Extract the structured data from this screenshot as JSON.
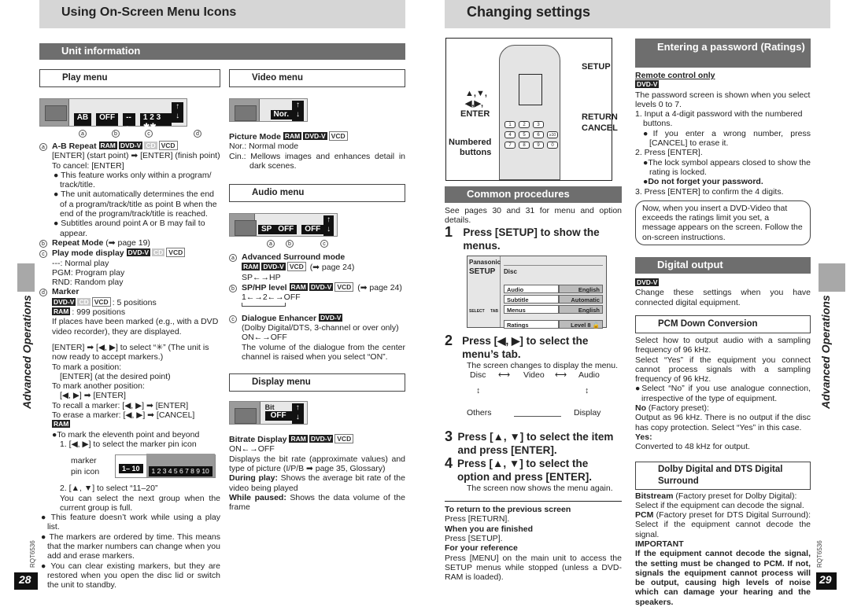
{
  "left_page": {
    "title": "Using On-Screen Menu Icons",
    "section": "Unit information",
    "side_label": "Advanced Operations",
    "doc_code": "RQT6536",
    "page_number": "28",
    "play_menu": {
      "title": "Play menu",
      "osd_values": [
        "AB",
        "OFF",
        "---",
        "1 2 3 ✱✱"
      ],
      "callouts": [
        "a",
        "b",
        "c",
        "d"
      ],
      "ab_repeat": {
        "label": "A-B Repeat",
        "tags": [
          "RAM",
          "DVD-V",
          "CD",
          "VCD"
        ],
        "lines": [
          "[ENTER] (start point) ➡ [ENTER] (finish point)",
          "To cancel: [ENTER]"
        ],
        "bullets": [
          "This feature works only within a program/ track/title.",
          "The unit automatically determines the end of a program/track/title as point B when the end of the program/track/title is reached.",
          "Subtitles around point A or B may fail to appear."
        ]
      },
      "repeat_mode": {
        "label": "Repeat Mode",
        "ref": "(➡ page 19)"
      },
      "play_mode": {
        "label": "Play mode display",
        "tags": [
          "DVD-V",
          "CD",
          "VCD"
        ],
        "lines": [
          "---: Normal play",
          "PGM: Program play",
          "RND: Random play"
        ]
      },
      "marker": {
        "label": "Marker",
        "tags_line1": [
          "DVD-V",
          "CD",
          "VCD"
        ],
        "line1": ": 5 positions",
        "tag_line2": "RAM",
        "line2": ": 999 positions",
        "desc": "If places have been marked (e.g., with a DVD video recorder), they are displayed.",
        "instr": [
          "[ENTER] ➡ [◀, ▶] to select “✳” (The unit is now ready to accept markers.)",
          "To mark a position:",
          "[ENTER] (at the desired point)",
          "To mark another position:",
          "[◀, ▶] ➡ [ENTER]",
          "To recall a marker:  [◀, ▶] ➡ [ENTER]",
          "To erase a marker:  [◀, ▶] ➡ [CANCEL]"
        ],
        "ram_tag": "RAM",
        "ram_bullet": "To mark the eleventh point and beyond",
        "step1": "1. [◀, ▶] to select the marker pin icon",
        "pin_label1": "marker",
        "pin_label2": "pin icon",
        "pin_group": "1– 10",
        "pin_numbers": "1 2 3 4 5 6 7 8 9 10",
        "step2": "2. [▲, ▼] to select “11–20”",
        "step2_desc": "You can select the next group when the current group is full.",
        "bullets": [
          "This feature doesn’t work while using a play list.",
          "The markers are ordered by time. This means that the marker numbers can change when you add and erase markers.",
          "You can clear existing markers, but they are restored when you open the disc lid or switch the unit to standby."
        ]
      }
    },
    "video_menu": {
      "title": "Video menu",
      "osd_value": "Nor.",
      "label": "Picture Mode",
      "tags": [
        "RAM",
        "DVD-V",
        "VCD"
      ],
      "lines": [
        "Nor.: Normal mode",
        "Cin.: Mellows images and enhances detail in dark scenes."
      ]
    },
    "audio_menu": {
      "title": "Audio menu",
      "osd_values": [
        "SP",
        "OFF",
        "OFF"
      ],
      "callouts": [
        "a",
        "b",
        "c"
      ],
      "surround": {
        "label": "Advanced Surround mode",
        "tags": [
          "RAM",
          "DVD-V",
          "VCD"
        ],
        "ref": "(➡ page 24)",
        "line": "SP←→HP"
      },
      "level": {
        "label": "SP/HP level",
        "tags": [
          "RAM",
          "DVD-V",
          "VCD"
        ],
        "ref": "(➡ page 24)",
        "line": "1←→2←→OFF"
      },
      "dialogue": {
        "label": "Dialogue Enhancer",
        "tags": [
          "DVD-V"
        ],
        "lines": [
          "(Dolby Digital/DTS, 3-channel or over only)",
          "ON←→OFF",
          "The volume of the dialogue from the center channel is raised when you select “ON”."
        ]
      }
    },
    "display_menu": {
      "title": "Display menu",
      "osd_label": "Bit",
      "osd_value": "OFF",
      "label": "Bitrate Display",
      "tags": [
        "RAM",
        "DVD-V",
        "VCD"
      ],
      "line": "ON←→OFF",
      "desc": "Displays the bit rate (approximate values) and type of picture (I/P/B ➡ page 35, Glossary)",
      "during_label": "During play:",
      "during_text": " Shows the average bit rate of the video being played",
      "paused_label": "While paused:",
      "paused_text": " Shows the data volume of the frame"
    }
  },
  "right_page": {
    "title": "Changing settings",
    "side_label": "Advanced Operations",
    "doc_code": "RQT6536",
    "page_number": "29",
    "remote": {
      "labels": {
        "setup": "SETUP",
        "arrows": "▲,▼,\n◀,▶,",
        "enter": "ENTER",
        "return": "RETURN",
        "cancel": "CANCEL",
        "numbered": "Numbered",
        "buttons": "buttons"
      },
      "keys": [
        "1",
        "2",
        "3",
        "4",
        "5",
        "6",
        "≥10",
        "7",
        "8",
        "9",
        "0"
      ]
    },
    "common": {
      "title": "Common procedures",
      "intro": "See pages 30 and 31 for menu and option details.",
      "step1": "Press [SETUP] to show the menus.",
      "screen": {
        "brand": "Panasonic",
        "setup": "SETUP",
        "tab": "Disc",
        "select": "SELECT",
        "tab_lbl": "TAB",
        "rows": [
          {
            "item": "Audio",
            "value": "English"
          },
          {
            "item": "Subtitle",
            "value": "Automatic"
          },
          {
            "item": "Menus",
            "value": "English"
          },
          {
            "item": "Ratings",
            "value": "Level 8 🔓"
          }
        ]
      },
      "step2": "Press [◀, ▶] to select the menu’s tab.",
      "step2_desc": "The screen changes to display the menu.",
      "tabs": [
        "Disc",
        "Video",
        "Audio",
        "Others",
        "Display"
      ],
      "step3": "Press [▲, ▼] to select the item and press [ENTER].",
      "step4": "Press [▲, ▼] to select the option and press [ENTER].",
      "step4_desc": "The screen now shows the menu again.",
      "notes": [
        {
          "h": "To return to the previous screen",
          "t": "Press [RETURN]."
        },
        {
          "h": "When you are finished",
          "t": "Press [SETUP]."
        },
        {
          "h": "For your reference",
          "t": "Press [MENU] on the main unit to access the SETUP menus while stopped (unless a DVD-RAM is loaded)."
        }
      ]
    },
    "password": {
      "title": "Entering a password (Ratings)",
      "remote_only": "Remote control only",
      "tag": "DVD-V",
      "intro": "The password screen is shown when you select levels 0 to 7.",
      "steps": [
        "1. Input a 4-digit password with the numbered buttons.",
        "●If you enter a wrong number, press [CANCEL] to erase it.",
        "2. Press [ENTER].",
        "●The lock symbol appears closed to show the rating is locked.",
        "●Do not forget your password.",
        "3. Press [ENTER] to confirm the 4 digits."
      ],
      "note": "Now, when you insert a DVD-Video that exceeds the ratings limit you set, a message appears on the screen. Follow the on-screen instructions."
    },
    "digital": {
      "title": "Digital output",
      "tag": "DVD-V",
      "intro": "Change these settings when you have connected digital equipment.",
      "pcm": {
        "title": "PCM Down Conversion",
        "lines": [
          "Select how to output audio with a sampling frequency of 96 kHz.",
          "Select “Yes” if the equipment you connect cannot process signals with a sampling frequency of 96 kHz.",
          "●Select “No” if you use analogue connection, irrespective of the type of equipment."
        ],
        "no_label": "No",
        "no_suffix": " (Factory preset):",
        "no_text": "Output as 96 kHz. There is no output if the disc has copy protection. Select “Yes” in this case.",
        "yes_label": "Yes:",
        "yes_text": "Converted to 48 kHz for output."
      },
      "dolby": {
        "title": "Dolby Digital and DTS Digital Surround",
        "bit_label": "Bitstream",
        "bit_text": " (Factory preset for Dolby Digital): Select if the equipment can decode the signal.",
        "pcm_label": "PCM",
        "pcm_text": " (Factory preset for DTS Digital Surround): Select if the equipment cannot decode the signal.",
        "important": "IMPORTANT",
        "warning": "If the equipment cannot decode the signal, the setting must be changed to PCM. If not, signals the equipment cannot process will be output, causing high levels of noise which can damage your hearing and the speakers."
      }
    }
  }
}
